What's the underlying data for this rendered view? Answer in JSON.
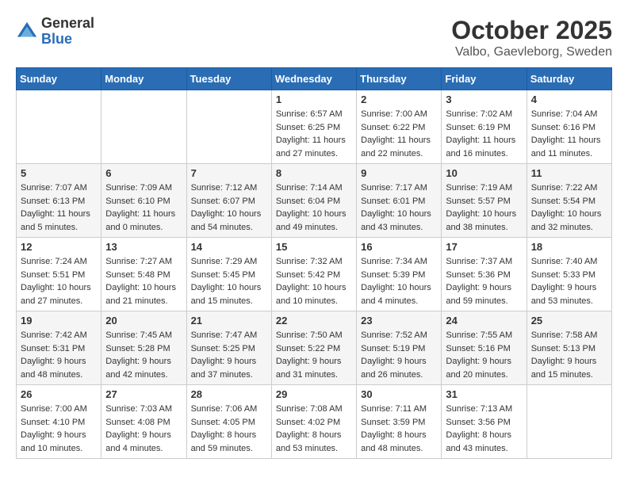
{
  "header": {
    "logo_general": "General",
    "logo_blue": "Blue",
    "month": "October 2025",
    "location": "Valbo, Gaevleborg, Sweden"
  },
  "weekdays": [
    "Sunday",
    "Monday",
    "Tuesday",
    "Wednesday",
    "Thursday",
    "Friday",
    "Saturday"
  ],
  "weeks": [
    [
      {
        "day": "",
        "info": ""
      },
      {
        "day": "",
        "info": ""
      },
      {
        "day": "",
        "info": ""
      },
      {
        "day": "1",
        "info": "Sunrise: 6:57 AM\nSunset: 6:25 PM\nDaylight: 11 hours and 27 minutes."
      },
      {
        "day": "2",
        "info": "Sunrise: 7:00 AM\nSunset: 6:22 PM\nDaylight: 11 hours and 22 minutes."
      },
      {
        "day": "3",
        "info": "Sunrise: 7:02 AM\nSunset: 6:19 PM\nDaylight: 11 hours and 16 minutes."
      },
      {
        "day": "4",
        "info": "Sunrise: 7:04 AM\nSunset: 6:16 PM\nDaylight: 11 hours and 11 minutes."
      }
    ],
    [
      {
        "day": "5",
        "info": "Sunrise: 7:07 AM\nSunset: 6:13 PM\nDaylight: 11 hours and 5 minutes."
      },
      {
        "day": "6",
        "info": "Sunrise: 7:09 AM\nSunset: 6:10 PM\nDaylight: 11 hours and 0 minutes."
      },
      {
        "day": "7",
        "info": "Sunrise: 7:12 AM\nSunset: 6:07 PM\nDaylight: 10 hours and 54 minutes."
      },
      {
        "day": "8",
        "info": "Sunrise: 7:14 AM\nSunset: 6:04 PM\nDaylight: 10 hours and 49 minutes."
      },
      {
        "day": "9",
        "info": "Sunrise: 7:17 AM\nSunset: 6:01 PM\nDaylight: 10 hours and 43 minutes."
      },
      {
        "day": "10",
        "info": "Sunrise: 7:19 AM\nSunset: 5:57 PM\nDaylight: 10 hours and 38 minutes."
      },
      {
        "day": "11",
        "info": "Sunrise: 7:22 AM\nSunset: 5:54 PM\nDaylight: 10 hours and 32 minutes."
      }
    ],
    [
      {
        "day": "12",
        "info": "Sunrise: 7:24 AM\nSunset: 5:51 PM\nDaylight: 10 hours and 27 minutes."
      },
      {
        "day": "13",
        "info": "Sunrise: 7:27 AM\nSunset: 5:48 PM\nDaylight: 10 hours and 21 minutes."
      },
      {
        "day": "14",
        "info": "Sunrise: 7:29 AM\nSunset: 5:45 PM\nDaylight: 10 hours and 15 minutes."
      },
      {
        "day": "15",
        "info": "Sunrise: 7:32 AM\nSunset: 5:42 PM\nDaylight: 10 hours and 10 minutes."
      },
      {
        "day": "16",
        "info": "Sunrise: 7:34 AM\nSunset: 5:39 PM\nDaylight: 10 hours and 4 minutes."
      },
      {
        "day": "17",
        "info": "Sunrise: 7:37 AM\nSunset: 5:36 PM\nDaylight: 9 hours and 59 minutes."
      },
      {
        "day": "18",
        "info": "Sunrise: 7:40 AM\nSunset: 5:33 PM\nDaylight: 9 hours and 53 minutes."
      }
    ],
    [
      {
        "day": "19",
        "info": "Sunrise: 7:42 AM\nSunset: 5:31 PM\nDaylight: 9 hours and 48 minutes."
      },
      {
        "day": "20",
        "info": "Sunrise: 7:45 AM\nSunset: 5:28 PM\nDaylight: 9 hours and 42 minutes."
      },
      {
        "day": "21",
        "info": "Sunrise: 7:47 AM\nSunset: 5:25 PM\nDaylight: 9 hours and 37 minutes."
      },
      {
        "day": "22",
        "info": "Sunrise: 7:50 AM\nSunset: 5:22 PM\nDaylight: 9 hours and 31 minutes."
      },
      {
        "day": "23",
        "info": "Sunrise: 7:52 AM\nSunset: 5:19 PM\nDaylight: 9 hours and 26 minutes."
      },
      {
        "day": "24",
        "info": "Sunrise: 7:55 AM\nSunset: 5:16 PM\nDaylight: 9 hours and 20 minutes."
      },
      {
        "day": "25",
        "info": "Sunrise: 7:58 AM\nSunset: 5:13 PM\nDaylight: 9 hours and 15 minutes."
      }
    ],
    [
      {
        "day": "26",
        "info": "Sunrise: 7:00 AM\nSunset: 4:10 PM\nDaylight: 9 hours and 10 minutes."
      },
      {
        "day": "27",
        "info": "Sunrise: 7:03 AM\nSunset: 4:08 PM\nDaylight: 9 hours and 4 minutes."
      },
      {
        "day": "28",
        "info": "Sunrise: 7:06 AM\nSunset: 4:05 PM\nDaylight: 8 hours and 59 minutes."
      },
      {
        "day": "29",
        "info": "Sunrise: 7:08 AM\nSunset: 4:02 PM\nDaylight: 8 hours and 53 minutes."
      },
      {
        "day": "30",
        "info": "Sunrise: 7:11 AM\nSunset: 3:59 PM\nDaylight: 8 hours and 48 minutes."
      },
      {
        "day": "31",
        "info": "Sunrise: 7:13 AM\nSunset: 3:56 PM\nDaylight: 8 hours and 43 minutes."
      },
      {
        "day": "",
        "info": ""
      }
    ]
  ]
}
